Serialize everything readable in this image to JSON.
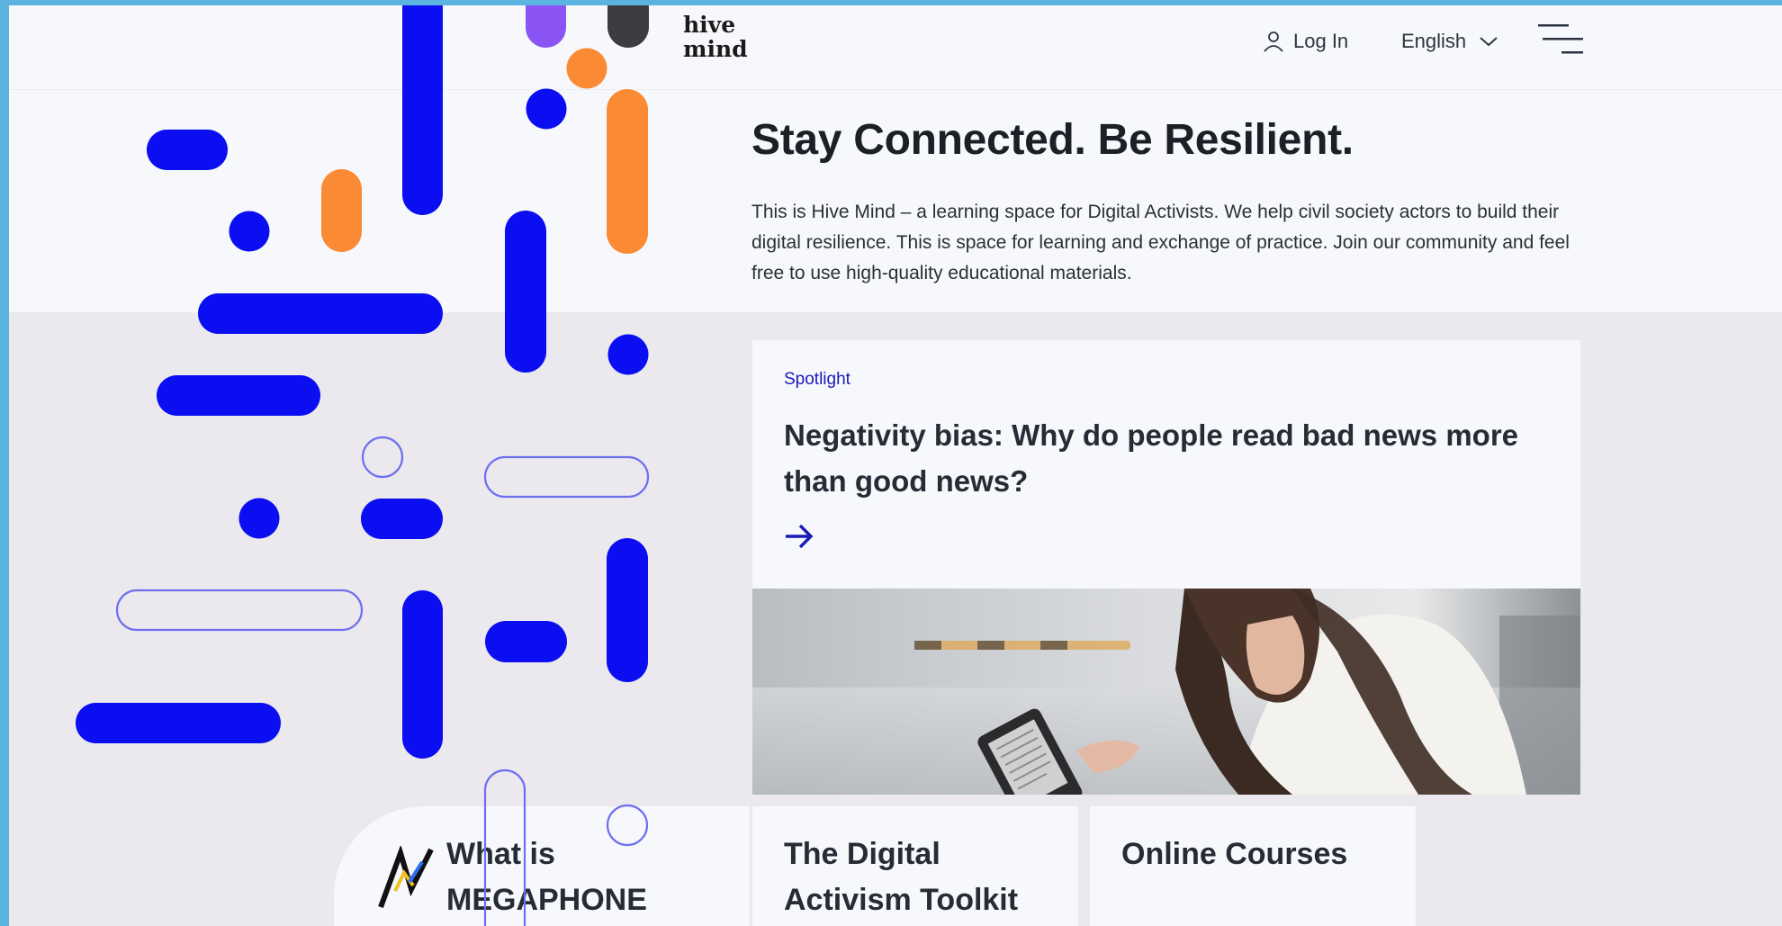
{
  "header": {
    "logo_line1": "hive",
    "logo_line2": "mind",
    "login_label": "Log In",
    "language_label": "English"
  },
  "hero": {
    "title": "Stay Connected. Be Resilient.",
    "text": "This is Hive Mind – a learning space for Digital Activists. We help civil society actors to build their digital resilience. This is space for learning and exchange of practice. Join our community and feel free to use high-quality educational materials."
  },
  "spotlight": {
    "label": "Spotlight",
    "title": "Negativity bias: Why do people read bad news more than good news?"
  },
  "cards": [
    {
      "title": "What is MEGAPHONE"
    },
    {
      "title": "The Digital Activism Toolkit"
    },
    {
      "title": "Online Courses"
    }
  ],
  "colors": {
    "accent_blue": "#0a0ef0",
    "accent_orange": "#fb8a34",
    "accent_purple": "#8a55f4",
    "link_blue": "#1a1ab8",
    "window_frame": "#5bb3e0"
  },
  "icons": {
    "login": "user-icon",
    "language": "chevron-down-icon",
    "menu": "hamburger-menu-icon",
    "spotlight": "arrow-right-icon",
    "megaphone": "megaphone-logo-icon"
  }
}
